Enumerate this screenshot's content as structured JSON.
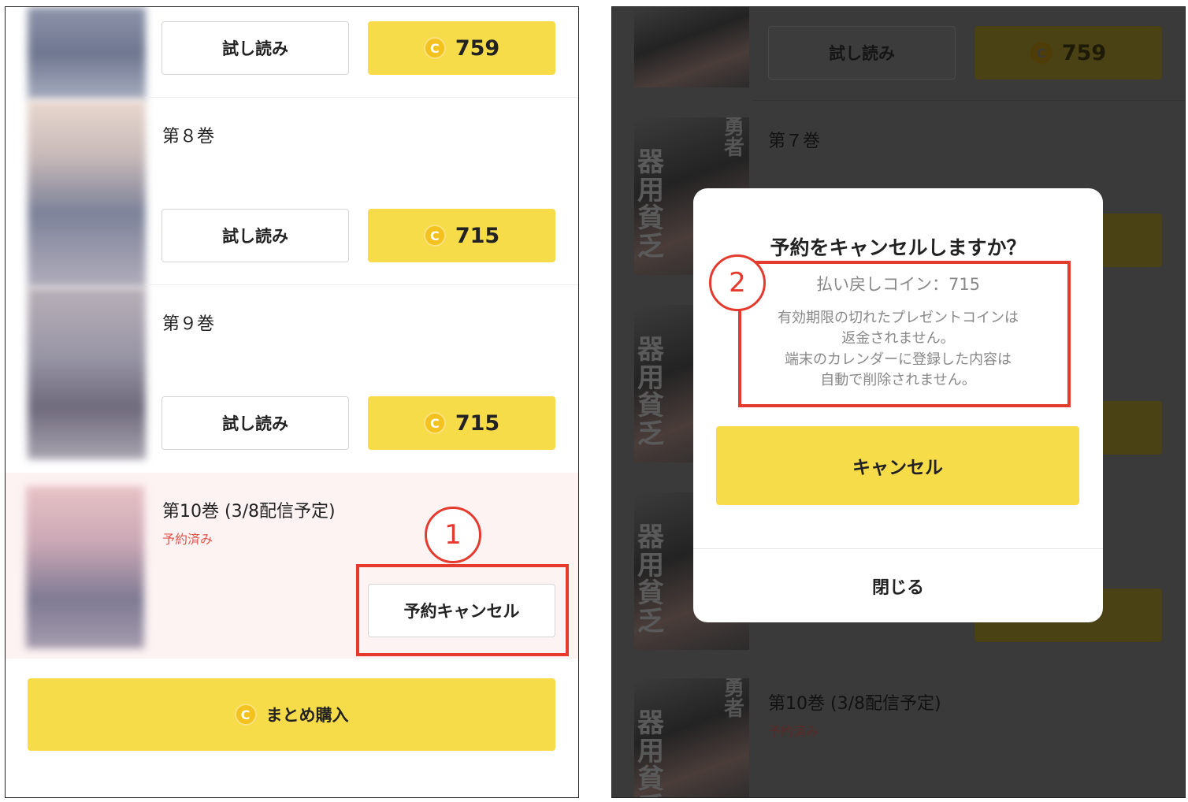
{
  "left": {
    "volumes": [
      {
        "trial_label": "試し読み",
        "price": "759",
        "coin_symbol": "C"
      },
      {
        "title": "第８巻",
        "trial_label": "試し読み",
        "price": "715",
        "coin_symbol": "C"
      },
      {
        "title": "第９巻",
        "trial_label": "試し読み",
        "price": "715",
        "coin_symbol": "C"
      },
      {
        "title": "第10巻 (3/8配信予定)",
        "status": "予約済み",
        "cancel_label": "予約キャンセル"
      }
    ],
    "bulk_buy_label": "まとめ購入",
    "bulk_coin_symbol": "C",
    "callout_number": "1"
  },
  "right": {
    "background": {
      "top_trial_label": "試し読み",
      "top_price": "759",
      "coin_symbol": "C",
      "vol7_title": "第７巻",
      "vol10_title": "第10巻 (3/8配信予定)",
      "vol10_status": "予約済み",
      "cover_kanji": "器用貧乏",
      "cover_yusha": "勇者"
    },
    "modal": {
      "title": "予約をキャンセルしますか？",
      "refund": "払い戻しコイン：715",
      "note_lines": [
        "有効期限の切れたプレゼントコインは",
        "返金されません。",
        "端末のカレンダーに登録した内容は",
        "自動で削除されません。"
      ],
      "cancel_label": "キャンセル",
      "close_label": "閉じる"
    },
    "callout_number": "2"
  },
  "colors": {
    "accent_yellow": "#f7dc4a",
    "coin": "#f4c21e",
    "callout_red": "#e53a2e",
    "reserved_red": "#e0554a",
    "overlay": "#3a3a3a"
  }
}
